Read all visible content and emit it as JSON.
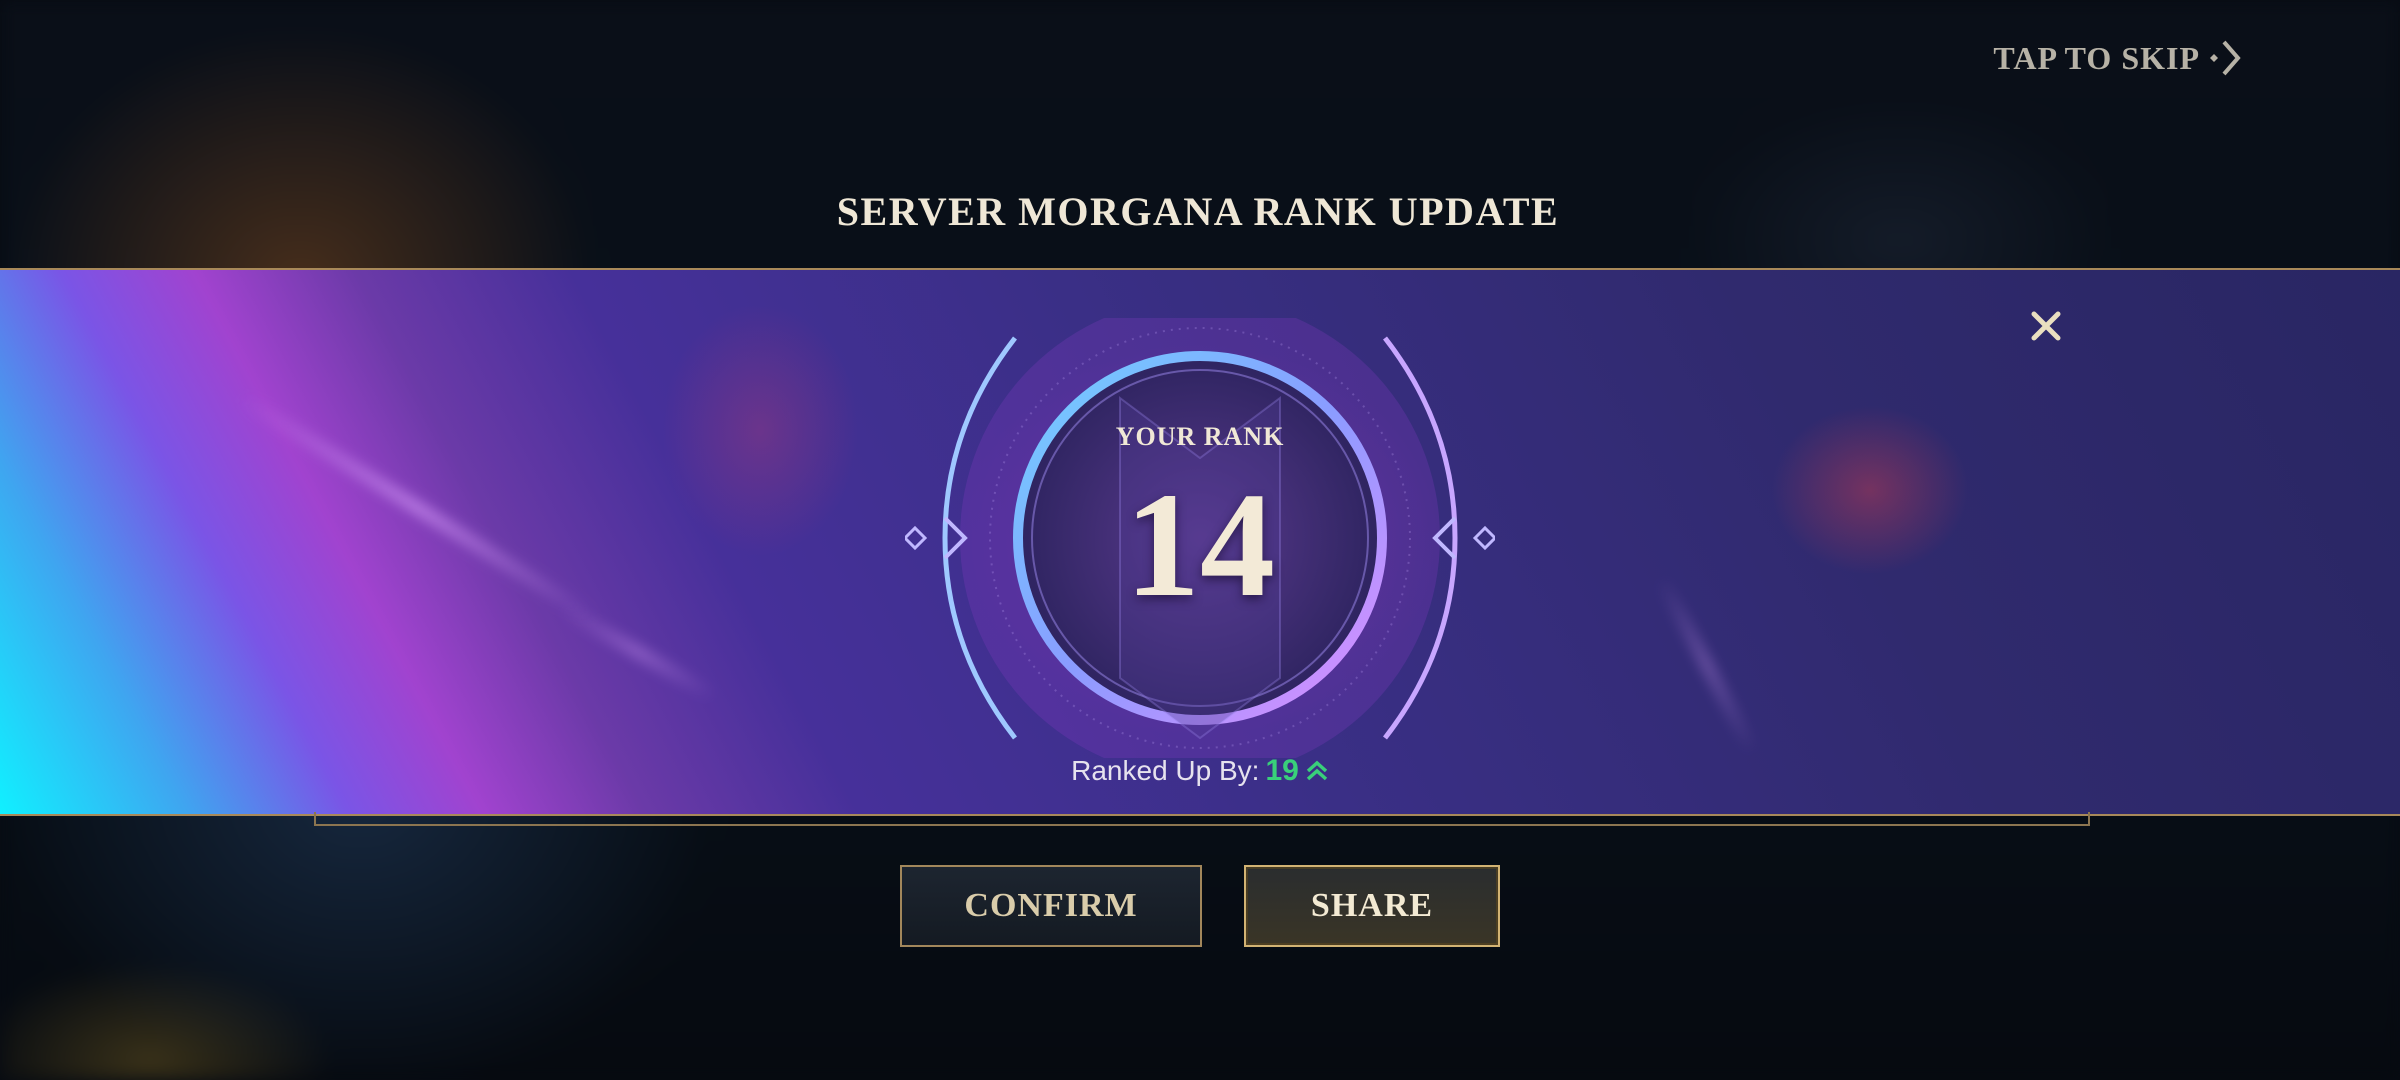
{
  "header": {
    "skip_label": "TAP TO SKIP",
    "title": "SERVER MORGANA RANK UPDATE"
  },
  "rank": {
    "label": "YOUR RANK",
    "value": "14",
    "ranked_up_label": "Ranked Up By:",
    "ranked_up_value": "19"
  },
  "buttons": {
    "confirm": "CONFIRM",
    "share": "SHARE"
  },
  "icons": {
    "skip": "skip-arrow-icon",
    "close": "close-icon",
    "rank_up": "double-chevron-up-icon"
  },
  "colors": {
    "gold_border": "#a8895a",
    "rank_up_green": "#39d07a",
    "text_cream": "#efe7d6"
  }
}
